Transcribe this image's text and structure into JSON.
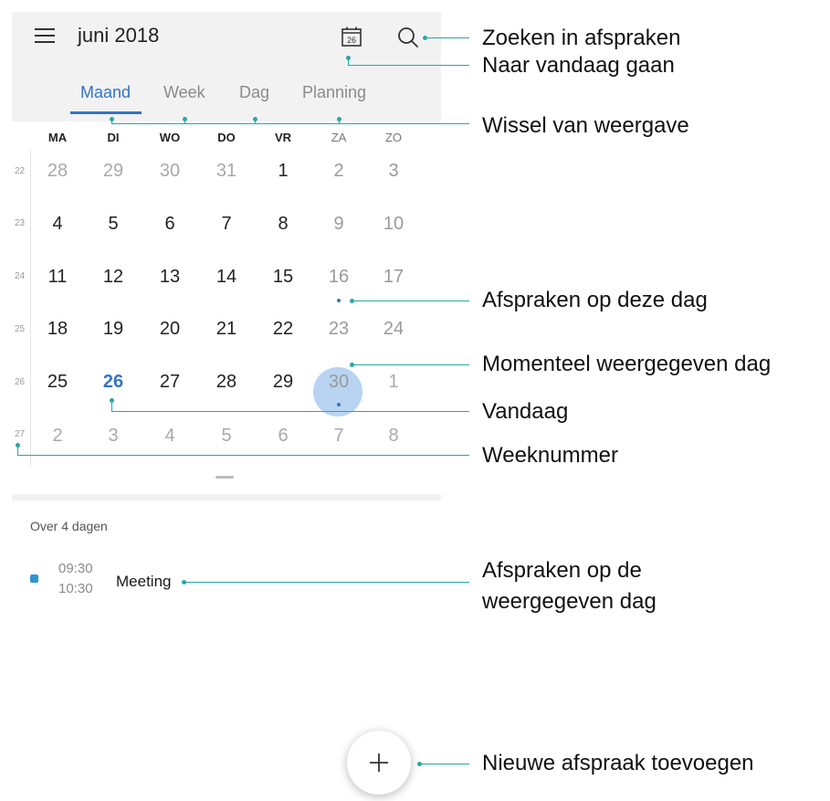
{
  "header": {
    "month_title": "juni 2018",
    "today_icon_day": "26",
    "menu_icon": "menu-icon",
    "search_icon": "search-icon"
  },
  "tabs": [
    {
      "label": "Maand",
      "active": true
    },
    {
      "label": "Week",
      "active": false
    },
    {
      "label": "Dag",
      "active": false
    },
    {
      "label": "Planning",
      "active": false
    }
  ],
  "weekdays": [
    "MA",
    "DI",
    "WO",
    "DO",
    "VR",
    "ZA",
    "ZO"
  ],
  "weeks": [
    {
      "number": "22",
      "days": [
        "28",
        "29",
        "30",
        "31",
        "1",
        "2",
        "3"
      ]
    },
    {
      "number": "23",
      "days": [
        "4",
        "5",
        "6",
        "7",
        "8",
        "9",
        "10"
      ]
    },
    {
      "number": "24",
      "days": [
        "11",
        "12",
        "13",
        "14",
        "15",
        "16",
        "17"
      ]
    },
    {
      "number": "25",
      "days": [
        "18",
        "19",
        "20",
        "21",
        "22",
        "23",
        "24"
      ]
    },
    {
      "number": "26",
      "days": [
        "25",
        "26",
        "27",
        "28",
        "29",
        "30",
        "1"
      ]
    },
    {
      "number": "27",
      "days": [
        "2",
        "3",
        "4",
        "5",
        "6",
        "7",
        "8"
      ]
    }
  ],
  "today": "26",
  "selected_day": "30",
  "agenda": {
    "header": "Over 4 dagen",
    "event": {
      "start": "09:30",
      "end": "10:30",
      "title": "Meeting"
    }
  },
  "colors": {
    "accent": "#3474c5",
    "callout": "#2aa6a6",
    "selected_circle": "#b8d4f2",
    "event": "#2f95d6"
  },
  "callouts": {
    "search": "Zoeken in afspraken",
    "today": "Naar vandaag gaan",
    "switch_view": "Wissel van weergave",
    "events_on_day": "Afspraken op deze dag",
    "current_day": "Momenteel weergegeven dag",
    "vandaag": "Vandaag",
    "week_number": "Weeknummer",
    "events_displayed_line1": "Afspraken op de",
    "events_displayed_line2": "weergegeven dag",
    "add_event": "Nieuwe afspraak toevoegen"
  }
}
